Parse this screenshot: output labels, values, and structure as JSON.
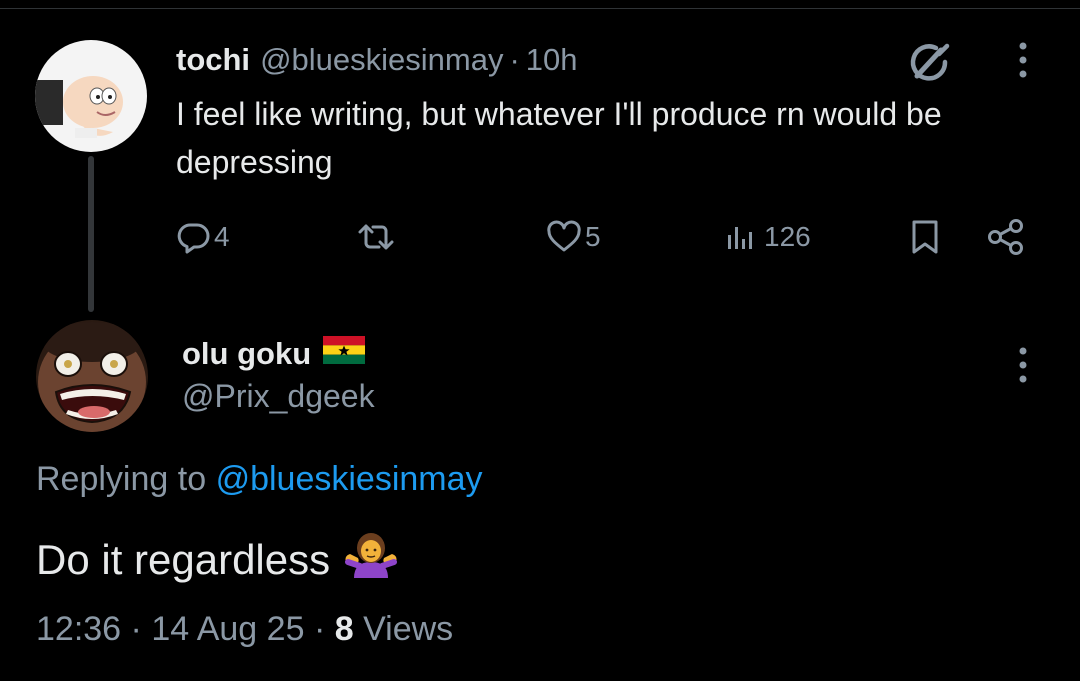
{
  "parent_tweet": {
    "display_name": "tochi",
    "handle": "@blueskiesinmay",
    "separator": "·",
    "time": "10h",
    "text": "I feel like writing, but whatever I'll produce rn would be depressing",
    "actions": {
      "reply_count": "4",
      "repost_count": "",
      "like_count": "5",
      "views_count": "126"
    },
    "icons": [
      "grok-icon",
      "more-icon",
      "reply-icon",
      "repost-icon",
      "like-icon",
      "views-icon",
      "bookmark-icon",
      "share-icon"
    ]
  },
  "reply_tweet": {
    "display_name": "olu goku",
    "flag": "ghana-flag",
    "handle": "@Prix_dgeek",
    "replying_label": "Replying to",
    "replying_mention": "@blueskiesinmay",
    "text": "Do it regardless",
    "emoji": "person-shrugging-emoji",
    "time": "12:36",
    "separator": "·",
    "date": "14 Aug 25",
    "views_count": "8",
    "views_label": "Views"
  },
  "colors": {
    "background": "#000000",
    "primary_text": "#e7e9ea",
    "secondary_text": "#8b98a5",
    "accent": "#1d9bf0",
    "thread_line": "#333639"
  }
}
